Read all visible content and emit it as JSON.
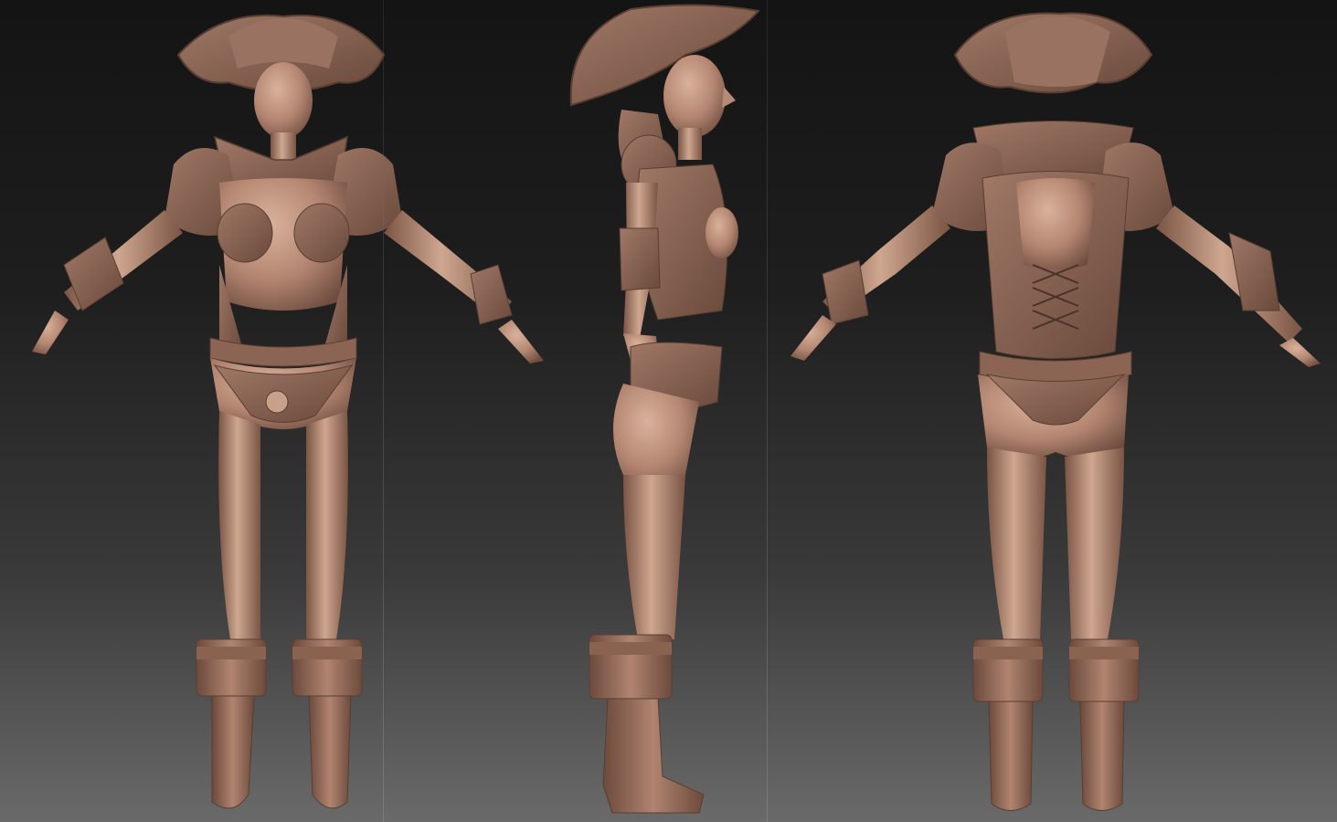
{
  "scene": {
    "background_top": "#141414",
    "background_bottom": "#6a6a6a",
    "clay_color": "#a47a68",
    "clay_shadow": "#6e4c3e",
    "clay_highlight": "#d4ab95"
  },
  "views": [
    {
      "id": "front",
      "icon": "front-view-figure"
    },
    {
      "id": "side",
      "icon": "side-view-figure"
    },
    {
      "id": "back",
      "icon": "back-view-figure"
    }
  ]
}
